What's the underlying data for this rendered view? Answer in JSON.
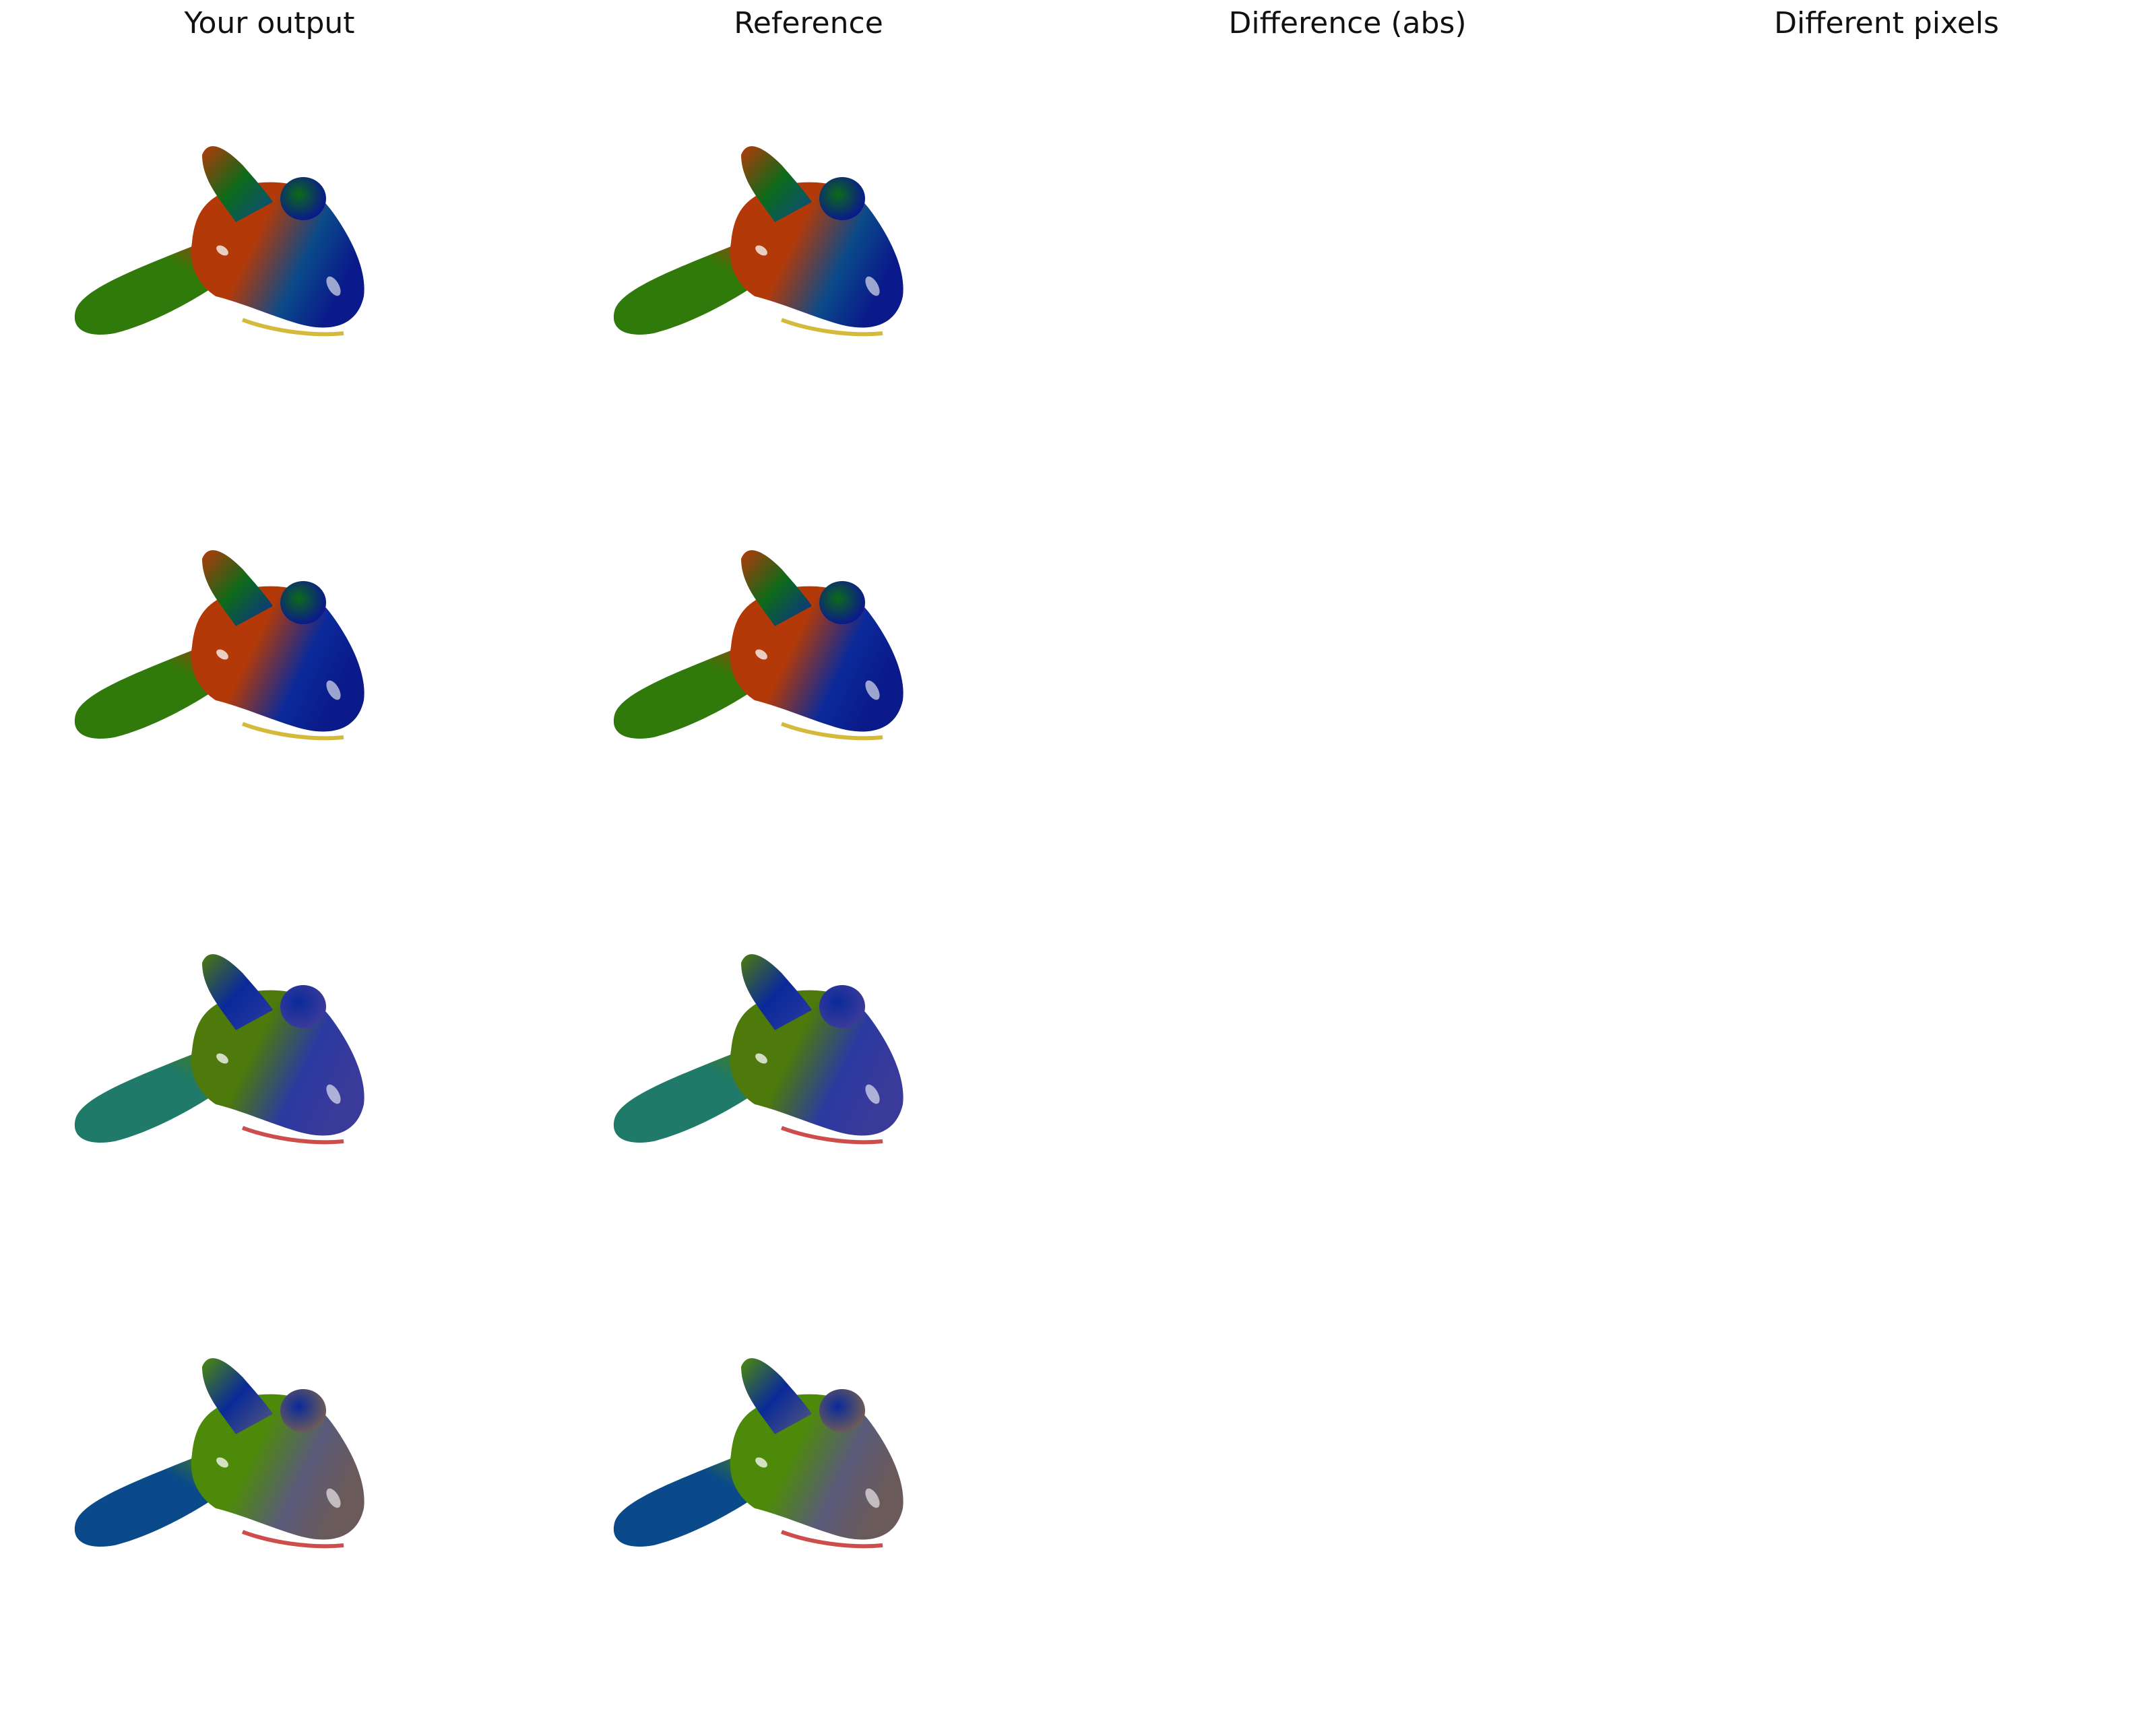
{
  "headers": [
    "Your output",
    "Reference",
    "Difference (abs)",
    "Different pixels"
  ],
  "rows": [
    {
      "variant": "row-1",
      "colors": {
        "tail": "#2f7a0a",
        "front": "#b33a08",
        "rear": "#0a4a8a",
        "nose": "#0a1a8a",
        "fin": "#0d6a1a",
        "rim": "#c9a80a"
      }
    },
    {
      "variant": "row-2",
      "colors": {
        "tail": "#2f7a0a",
        "front": "#b33a08",
        "rear": "#0b2a9a",
        "nose": "#0a1a8a",
        "fin": "#0d6a1a",
        "rim": "#c9a80a"
      }
    },
    {
      "variant": "row-3",
      "colors": {
        "tail": "#1f7a6a",
        "front": "#4d7a0a",
        "rear": "#2a3aa0",
        "nose": "#3a3a9a",
        "fin": "#0a2a9a",
        "rim": "#c02020"
      }
    },
    {
      "variant": "row-4",
      "colors": {
        "tail": "#0a4a8a",
        "front": "#4d8a0a",
        "rear": "#5a5a7a",
        "nose": "#6a5a5a",
        "fin": "#0a2a9a",
        "rim": "#c02020"
      }
    }
  ]
}
